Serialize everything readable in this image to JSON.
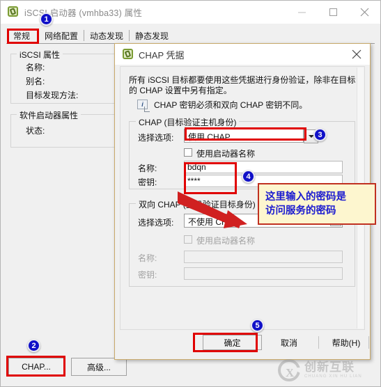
{
  "window": {
    "title": "iSCSI 启动器 (vmhba33) 属性",
    "icon": "iscsi-initiator-icon",
    "controls": {
      "minimize": "minimize-icon",
      "maximize": "maximize-icon",
      "close": "close-icon"
    },
    "tabs": [
      {
        "label": "常规",
        "selected": true
      },
      {
        "label": "网络配置",
        "selected": false
      },
      {
        "label": "动态发现",
        "selected": false
      },
      {
        "label": "静态发现",
        "selected": false
      }
    ],
    "groups": [
      {
        "title": "iSCSI 属性",
        "fields": [
          {
            "label": "名称:",
            "value": ""
          },
          {
            "label": "别名:",
            "value": ""
          },
          {
            "label": "目标发现方法:",
            "value": ""
          }
        ]
      },
      {
        "title": "软件启动器属性",
        "fields": [
          {
            "label": "状态:",
            "value": ""
          }
        ]
      }
    ],
    "buttons": [
      {
        "label": "CHAP...",
        "highlighted": true
      },
      {
        "label": "高级...",
        "highlighted": false
      }
    ]
  },
  "dialog": {
    "title": "CHAP 凭据",
    "icon": "iscsi-initiator-icon",
    "close_icon": "close-icon",
    "description_line1": "所有 iSCSI 目标都要使用这些凭据进行身份验证，除非在目标",
    "description_line2": "的 CHAP 设置中另有指定。",
    "note_icon": "info-icon",
    "note": "CHAP 密钥必须和双向 CHAP 密钥不同。",
    "chap": {
      "group_title": "CHAP (目标验证主机身份)",
      "select_label": "选择选项:",
      "select_value": "使用 CHAP",
      "select_options": [
        "不使用 CHAP",
        "使用 CHAP"
      ],
      "checkbox_label": "使用启动器名称",
      "checkbox_checked": false,
      "name_label": "名称:",
      "name_value": "bdqn",
      "secret_label": "密钥:",
      "secret_value": "****"
    },
    "mutual_chap": {
      "group_title": "双向 CHAP (主机验证目标身份)",
      "select_label": "选择选项:",
      "select_value": "不使用 CHAP",
      "select_options": [
        "不使用 CHAP",
        "使用 CHAP"
      ],
      "checkbox_label": "使用启动器名称",
      "checkbox_checked": false,
      "name_label": "名称:",
      "name_value": "",
      "secret_label": "密钥:",
      "secret_value": ""
    },
    "buttons": {
      "ok": "确定",
      "cancel": "取消",
      "help": "帮助(H)"
    }
  },
  "annotations": {
    "badges": [
      "1",
      "2",
      "3",
      "4",
      "5"
    ],
    "callout_line1": "这里输入的密码是",
    "callout_line2": "访问服务的密码",
    "highlight_color": "#e00000",
    "badge_color": "#1010c8",
    "callout_bg": "#fdf6cf",
    "callout_text_color": "#1b1bd0"
  },
  "watermark": {
    "cn": "创新互联",
    "en": "CHUANG XIN HU LIAN"
  }
}
